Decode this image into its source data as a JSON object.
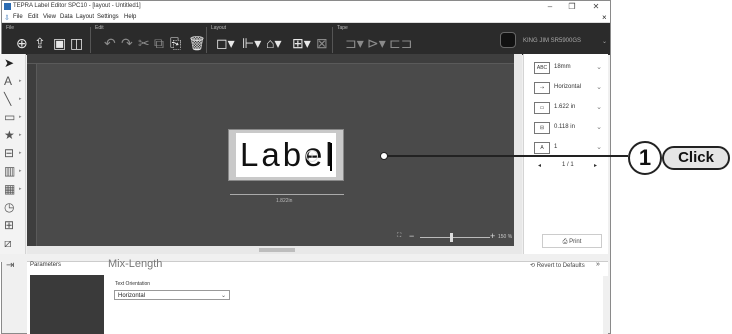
{
  "app": {
    "title": "TEPRA Label Editor SPC10 - [layout - Untitled1]"
  },
  "window": {
    "minimize": "–",
    "restore": "❐",
    "close": "✕",
    "sub_close": "×"
  },
  "menu": [
    "File",
    "Edit",
    "View",
    "Data",
    "Layout",
    "Settings",
    "Help"
  ],
  "ribbon": {
    "file": "File",
    "edit": "Edit",
    "layout": "Layout",
    "tape": "Tape",
    "printer_name": "KING JIM SR5900GS"
  },
  "canvas": {
    "label_text": "Label",
    "dimension": "1.822in",
    "zoom": "150 %",
    "zoom_minus": "−",
    "zoom_plus": "+"
  },
  "right_panel": {
    "tape_width": "18mm",
    "orientation": "Horizontal",
    "length": "1.622 in",
    "margin": "0.118 in",
    "copies": "1",
    "page": "1 / 1",
    "print": "Print"
  },
  "bottom": {
    "parameters": "Parameters",
    "mode": "Mix-Length",
    "revert": "Revert to Defaults",
    "text_orientation_label": "Text Orientation",
    "text_orientation_value": "Horizontal"
  },
  "callout": {
    "number": "1",
    "action": "Click"
  },
  "colors": {
    "ribbon": "#2b2b2b",
    "canvas": "#4a4a4a",
    "accent": "#222222"
  }
}
